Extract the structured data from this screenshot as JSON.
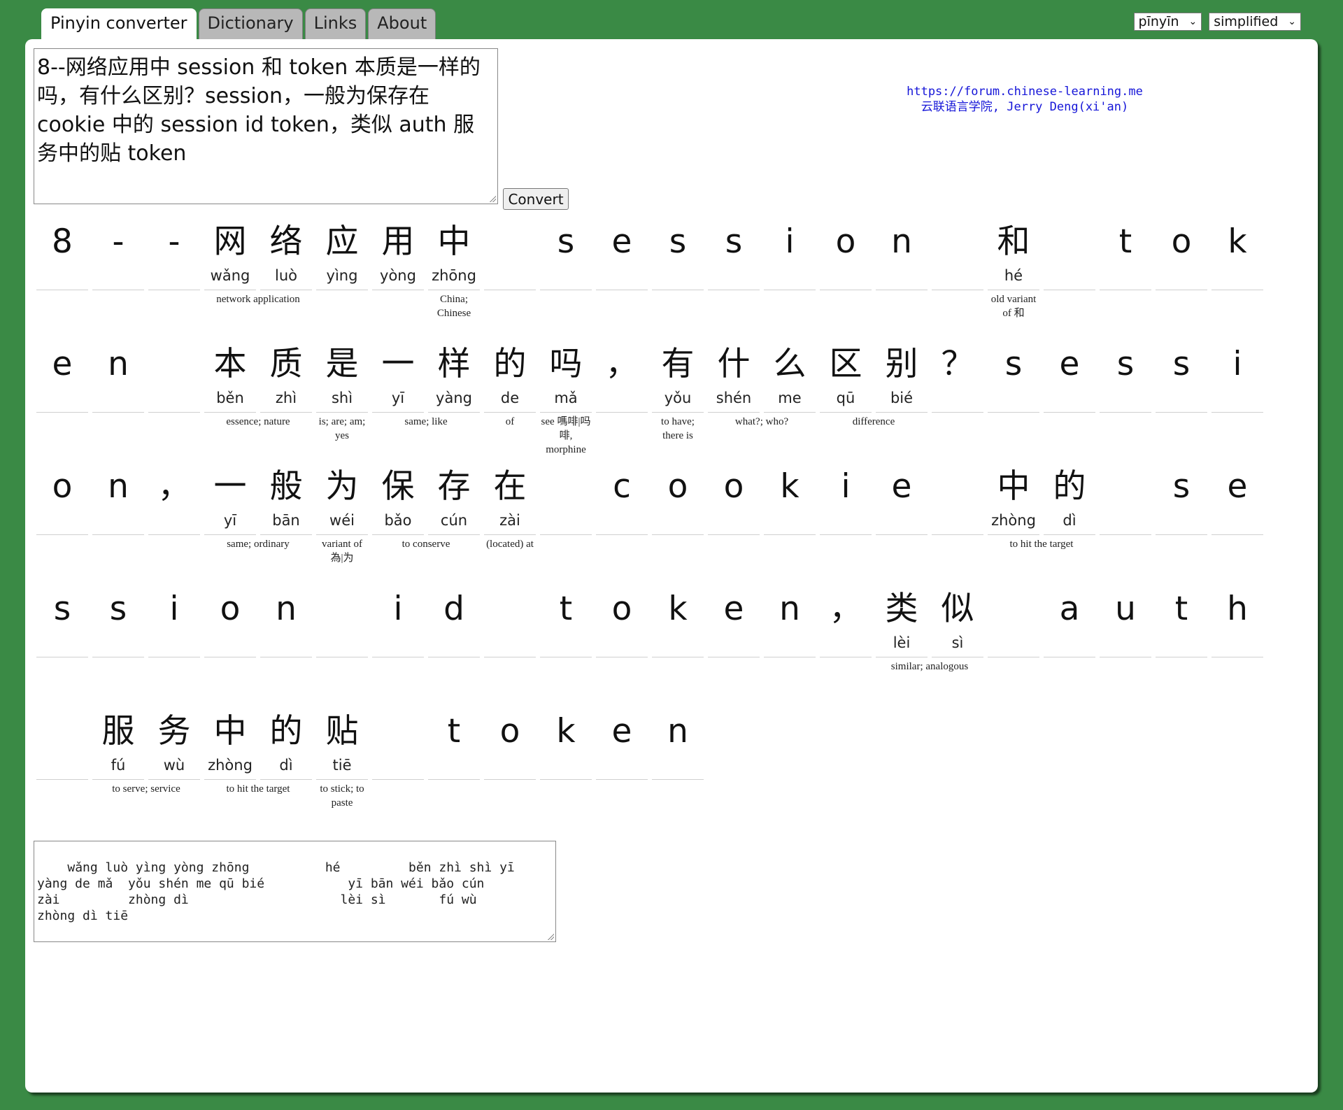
{
  "tabs": [
    "Pinyin converter",
    "Dictionary",
    "Links",
    "About"
  ],
  "selects": {
    "tone_mode": "pīnyīn",
    "script": "simplified"
  },
  "input_text": "8--网络应用中 session 和 token 本质是一样的吗，有什么区别？session，一般为保存在 cookie 中的 session id token，类似 auth 服务中的贴 token",
  "convert_label": "Convert",
  "site": {
    "url": "https://forum.chinese-learning.me",
    "credit": "云联语言学院, Jerry Deng(xi'an)"
  },
  "icons": {
    "select_arrow": "chevron-down-icon",
    "resize": "resize-grip-icon"
  },
  "cells": [
    {
      "c": "8"
    },
    {
      "c": "-"
    },
    {
      "c": "-"
    },
    {
      "c": "网",
      "p": "wǎng",
      "d": "network application",
      "s": 2
    },
    {
      "c": "络",
      "p": "luò"
    },
    {
      "c": "应",
      "p": "yìng"
    },
    {
      "c": "用",
      "p": "yòng"
    },
    {
      "c": "中",
      "p": "zhōng",
      "d": "China; Chinese",
      "s": 1
    },
    {
      "c": " "
    },
    {
      "c": "s"
    },
    {
      "c": "e"
    },
    {
      "c": "s"
    },
    {
      "c": "s"
    },
    {
      "c": "i"
    },
    {
      "c": "o"
    },
    {
      "c": "n"
    },
    {
      "c": " "
    },
    {
      "c": "和",
      "p": "hé",
      "d": "old variant of 和",
      "s": 1
    },
    {
      "c": " "
    },
    {
      "c": "t"
    },
    {
      "c": "o"
    },
    {
      "c": "k"
    },
    {
      "c": "e"
    },
    {
      "c": "n"
    },
    {
      "c": " "
    },
    {
      "c": "本",
      "p": "běn",
      "d": "essence; nature",
      "s": 2
    },
    {
      "c": "质",
      "p": "zhì"
    },
    {
      "c": "是",
      "p": "shì",
      "d": "is; are; am; yes",
      "s": 1
    },
    {
      "c": "一",
      "p": "yī",
      "d": "same; like",
      "s": 2
    },
    {
      "c": "样",
      "p": "yàng"
    },
    {
      "c": "的",
      "p": "de",
      "d": "of",
      "s": 1
    },
    {
      "c": "吗",
      "p": "mǎ",
      "d": "see 嗎啡|吗啡, morphine",
      "s": 1
    },
    {
      "c": "，"
    },
    {
      "c": "有",
      "p": "yǒu",
      "d": "to have; there is",
      "s": 1
    },
    {
      "c": "什",
      "p": "shén",
      "d": "what?; who?",
      "s": 2
    },
    {
      "c": "么",
      "p": "me"
    },
    {
      "c": "区",
      "p": "qū",
      "d": "difference",
      "s": 2
    },
    {
      "c": "别",
      "p": "bié"
    },
    {
      "c": "？"
    },
    {
      "c": "s"
    },
    {
      "c": "e"
    },
    {
      "c": "s"
    },
    {
      "c": "s"
    },
    {
      "c": "i"
    },
    {
      "c": "o"
    },
    {
      "c": "n"
    },
    {
      "c": "，"
    },
    {
      "c": "一",
      "p": "yī",
      "d": "same; ordinary",
      "s": 2
    },
    {
      "c": "般",
      "p": "bān"
    },
    {
      "c": "为",
      "p": "wéi",
      "d": "variant of 為|为",
      "s": 1
    },
    {
      "c": "保",
      "p": "bǎo",
      "d": "to conserve",
      "s": 2
    },
    {
      "c": "存",
      "p": "cún"
    },
    {
      "c": "在",
      "p": "zài",
      "d": "(located) at",
      "s": 1
    },
    {
      "c": " "
    },
    {
      "c": "c"
    },
    {
      "c": "o"
    },
    {
      "c": "o"
    },
    {
      "c": "k"
    },
    {
      "c": "i"
    },
    {
      "c": "e"
    },
    {
      "c": " "
    },
    {
      "c": "中",
      "p": "zhòng",
      "d": "to hit the target",
      "s": 2
    },
    {
      "c": "的",
      "p": "dì"
    },
    {
      "c": " "
    },
    {
      "c": "s"
    },
    {
      "c": "e"
    },
    {
      "c": "s"
    },
    {
      "c": "s"
    },
    {
      "c": "i"
    },
    {
      "c": "o"
    },
    {
      "c": "n"
    },
    {
      "c": " "
    },
    {
      "c": "i"
    },
    {
      "c": "d"
    },
    {
      "c": " "
    },
    {
      "c": "t"
    },
    {
      "c": "o"
    },
    {
      "c": "k"
    },
    {
      "c": "e"
    },
    {
      "c": "n"
    },
    {
      "c": "，"
    },
    {
      "c": "类",
      "p": "lèi",
      "d": "similar; analogous",
      "s": 2
    },
    {
      "c": "似",
      "p": "sì"
    },
    {
      "c": " "
    },
    {
      "c": "a"
    },
    {
      "c": "u"
    },
    {
      "c": "t"
    },
    {
      "c": "h"
    },
    {
      "c": " "
    },
    {
      "c": "服",
      "p": "fú",
      "d": "to serve; service",
      "s": 2
    },
    {
      "c": "务",
      "p": "wù"
    },
    {
      "c": "中",
      "p": "zhòng",
      "d": "to hit the target",
      "s": 2
    },
    {
      "c": "的",
      "p": "dì"
    },
    {
      "c": "贴",
      "p": "tiē",
      "d": "to stick; to paste",
      "s": 1
    },
    {
      "c": " "
    },
    {
      "c": "t"
    },
    {
      "c": "o"
    },
    {
      "c": "k"
    },
    {
      "c": "e"
    },
    {
      "c": "n"
    }
  ],
  "pinyin_output": "  wǎng luò yìng yòng zhōng          hé         běn zhì shì yī\nyàng de mǎ  yǒu shén me qū bié           yī bān wéi bǎo cún\nzài         zhòng dì                    lèi sì       fú wù\nzhòng dì tiē"
}
